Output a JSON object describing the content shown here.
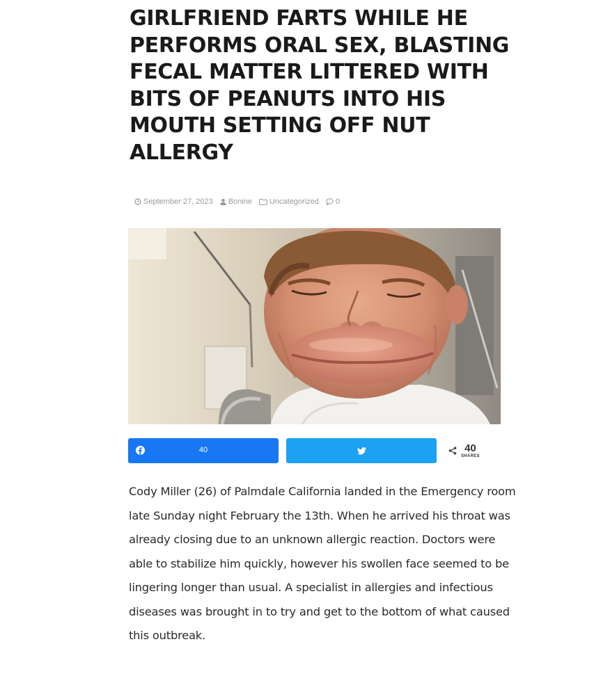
{
  "article": {
    "title": "GIRLFRIEND FARTS WHILE HE PERFORMS ORAL SEX, BLASTING FECAL MATTER LITTERED WITH BITS OF PEANUTS INTO HIS MOUTH SETTING OFF NUT ALLERGY",
    "meta": {
      "date": "September 27, 2023",
      "author": "Bonine",
      "category": "Uncategorized",
      "comments": "0",
      "icons": [
        "clock-icon",
        "user-icon",
        "folder-icon",
        "comment-icon"
      ]
    },
    "photo": {
      "icon": "featured-photo"
    },
    "share": {
      "facebook_count": "40",
      "facebook_icon": "facebook-icon",
      "twitter_icon": "twitter-icon",
      "total_count": "40",
      "total_label": "SHARES",
      "colors": {
        "facebook": "#1877f2",
        "twitter": "#1da1f2"
      }
    },
    "body": "Cody Miller (26) of Palmdale California landed in the Emergency room late Sunday night February the 13th. When he arrived his throat was already closing due to an unknown allergic reaction. Doctors were able to stabilize him quickly, however his swollen face seemed to be lingering longer than usual. A specialist in allergies and infectious diseases was brought in to try and get to the bottom of what caused this outbreak."
  }
}
